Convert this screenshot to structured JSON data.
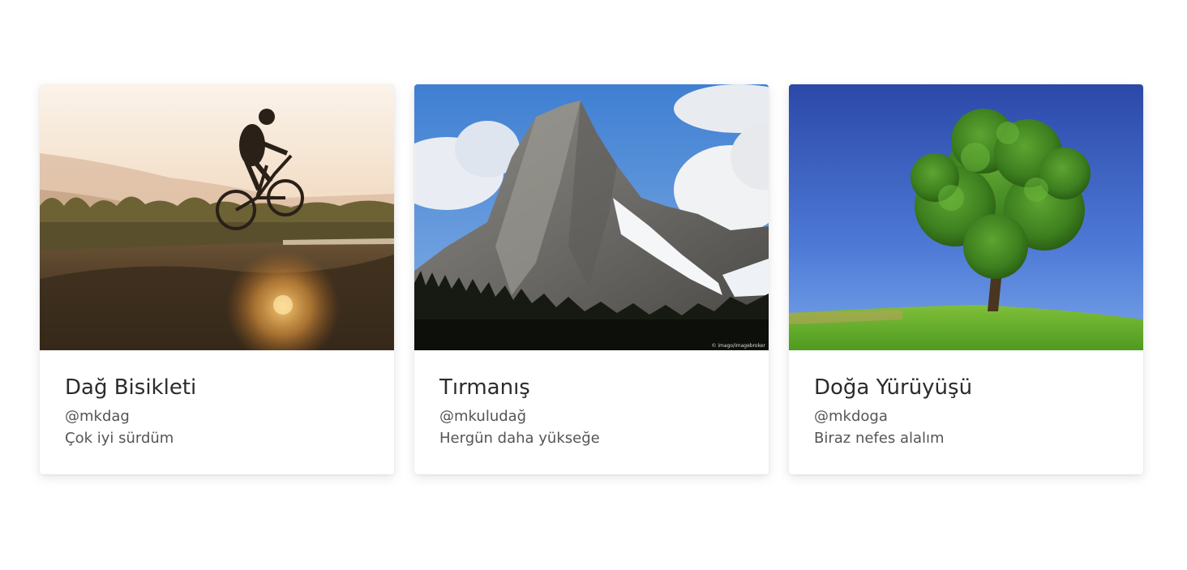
{
  "cards": [
    {
      "image_icon": "mountain-biker-photo",
      "title": "Dağ Bisikleti",
      "handle": "@mkdag",
      "text": "Çok iyi sürdüm"
    },
    {
      "image_icon": "mountain-peak-photo",
      "title": "Tırmanış",
      "handle": "@mkuludağ",
      "text": "Hergün daha yükseğe"
    },
    {
      "image_icon": "tree-meadow-photo",
      "title": "Doğa Yürüyüşü",
      "handle": "@mkdoga",
      "text": "Biraz nefes alalım"
    }
  ],
  "colors": {
    "title": "#2b2b2b",
    "text": "#555555",
    "card_bg": "#ffffff"
  }
}
